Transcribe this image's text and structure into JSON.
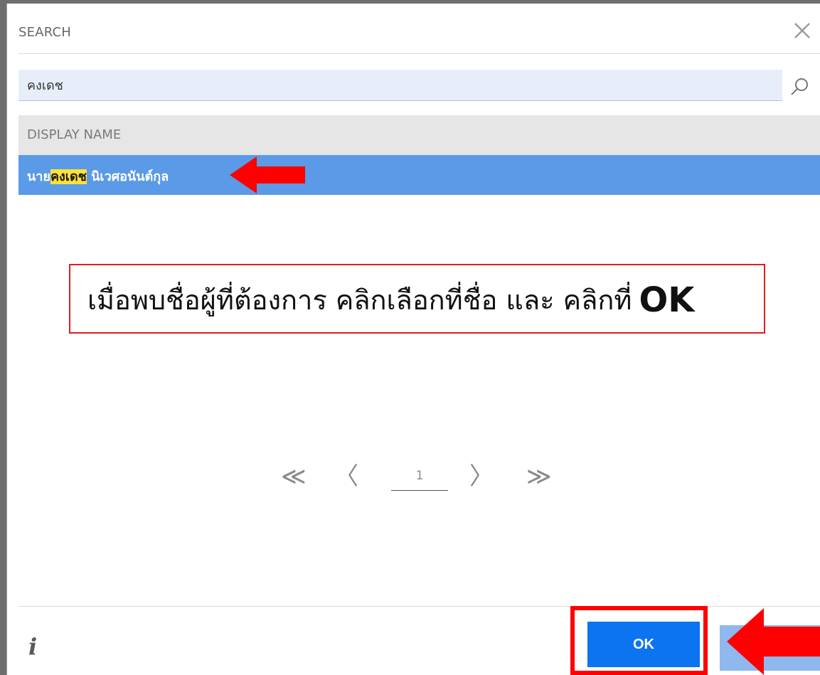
{
  "dialog": {
    "title": "SEARCH",
    "search": {
      "value": "คงเดช",
      "placeholder": ""
    },
    "column_header": "DISPLAY NAME",
    "result": {
      "prefix": "นาย",
      "match": "คงเดช",
      "suffix": " นิเวศอนันต์กุล"
    },
    "pagination": {
      "first": "≪",
      "prev": "〈",
      "current_page": "1",
      "next": "〉",
      "last": "≫"
    },
    "ok_label": "OK",
    "info_icon_glyph": "i"
  },
  "annotation": {
    "text": "เมื่อพบชื่อผู้ที่ต้องการ คลิกเลือกที่ชื่อ และ คลิกที่",
    "ok_text": "OK"
  },
  "colors": {
    "selection": "#5b9ae6",
    "highlight": "#ffe23a",
    "primary_button": "#0c74f0",
    "annotation_red": "#ff0000"
  }
}
